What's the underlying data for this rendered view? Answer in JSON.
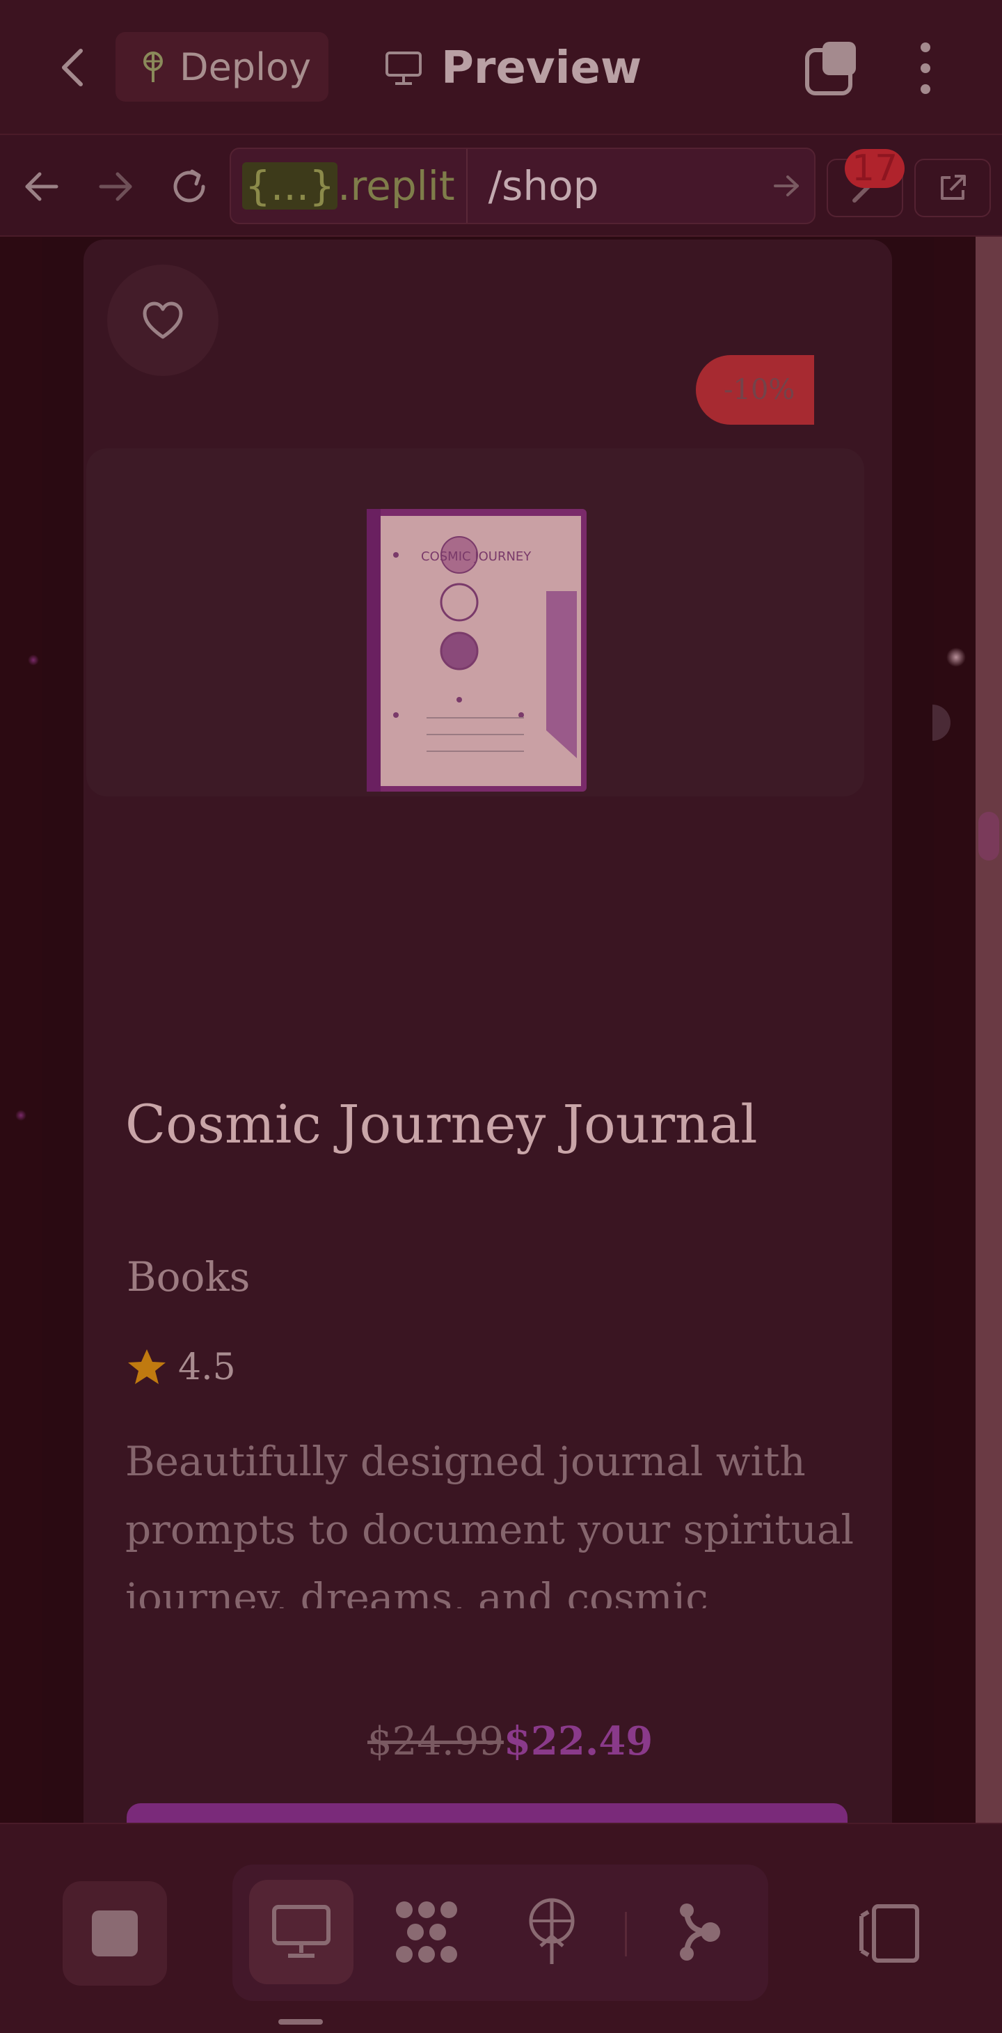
{
  "topbar": {
    "deploy_label": "Deploy",
    "preview_label": "Preview",
    "icons": [
      "back-icon",
      "deploy-icon",
      "monitor-icon",
      "tabs-icon",
      "more-icon"
    ]
  },
  "urlbar": {
    "host_braces": "{...}",
    "host_domain": ".replit",
    "path": "/shop",
    "badge_count": "17",
    "icons": [
      "arrow-left-icon",
      "arrow-right-icon",
      "reload-icon",
      "go-arrow-icon",
      "wrench-icon",
      "external-link-icon"
    ]
  },
  "product": {
    "discount": "-10%",
    "book_cover_title": "COSMIC JOURNEY",
    "title": "Cosmic Journey Journal",
    "category": "Books",
    "rating": "4.5",
    "description": "Beautifully designed journal with prompts to document your spiritual journey, dreams, and cosmic insights...",
    "old_price": "$24.99",
    "new_price": "$22.49"
  },
  "bottombar": {
    "icons": [
      "stop-icon",
      "monitor-icon",
      "pattern-icon",
      "deploy-icon",
      "share-node-icon",
      "panel-icon"
    ]
  },
  "colors": {
    "accent_purple": "#7a2a7a",
    "discount_red": "#a72a31",
    "star_gold": "#c07a10"
  }
}
